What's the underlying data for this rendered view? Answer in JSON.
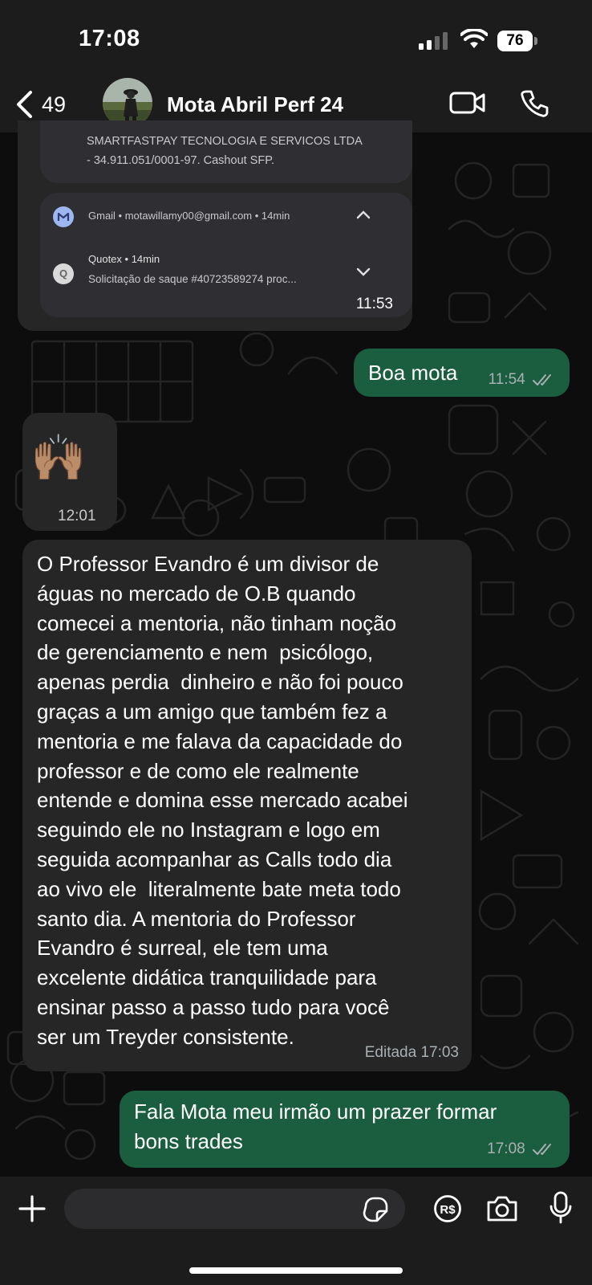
{
  "status_bar": {
    "time": "17:08",
    "battery": "76"
  },
  "header": {
    "back_count": "49",
    "contact_name": "Mota Abril Perf 24"
  },
  "messages": {
    "screenshot": {
      "company_line1": "SMARTFASTPAY TECNOLOGIA E SERVICOS LTDA",
      "company_line2": "- 34.911.051/0001-97. Cashout SFP.",
      "gmail_line": "Gmail • motawillamy00@gmail.com • 14min",
      "quotex_title": "Quotex • 14min",
      "quotex_body": "Solicitação de saque #40723589274 proc...",
      "quotex_icon_letter": "Q",
      "time": "11:53"
    },
    "boa_mota": {
      "text": "Boa mota",
      "time": "11:54"
    },
    "emoji": {
      "text": "🙌🏽",
      "time": "12:01"
    },
    "testimonial": {
      "lines": [
        "O Professor Evandro é um divisor de",
        "águas no mercado de O.B quando",
        "comecei a mentoria, não tinham noção",
        "de gerenciamento e nem  psicólogo,",
        "apenas perdia  dinheiro e não foi pouco",
        "graças a um amigo que também fez a",
        "mentoria e me falava da capacidade do",
        "professor e de como ele realmente",
        "entende e domina esse mercado acabei",
        "seguindo ele no Instagram e logo em",
        "seguida acompanhar as Calls todo dia",
        "ao vivo ele  literalmente bate meta todo",
        "santo dia. A mentoria do Professor",
        "Evandro é surreal, ele tem uma",
        "excelente didática tranquilidade para",
        "ensinar passo a passo tudo para você",
        "ser um Treyder consistente."
      ],
      "meta": "Editada 17:03"
    },
    "fala_mota": {
      "line1": "Fala Mota meu irmão um prazer formar",
      "line2": "bons trades",
      "time": "17:08"
    }
  },
  "input_bar": {
    "placeholder": "",
    "pix_label": "R$"
  },
  "colors": {
    "outgoing_bubble": "#1b5e3f",
    "incoming_bubble": "#262626",
    "read_tick": "#a8b0b4"
  }
}
